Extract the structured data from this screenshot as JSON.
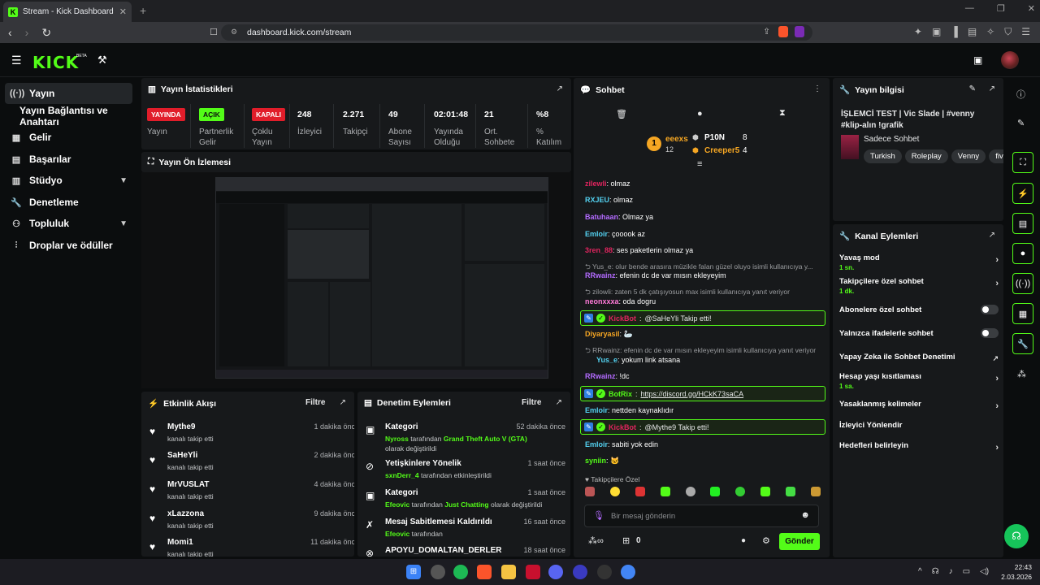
{
  "browser": {
    "tab_title": "Stream - Kick Dashboard",
    "url": "dashboard.kick.com/stream"
  },
  "header": {
    "logo": "KICK",
    "beta": "BETA"
  },
  "sidebar": {
    "items": [
      {
        "label": "Yayın",
        "icon": "broadcast-icon"
      },
      {
        "label": "Yayın Bağlantısı ve Anahtarı"
      },
      {
        "label": "Gelir",
        "icon": "revenue-icon"
      },
      {
        "label": "Başarılar",
        "icon": "achievements-icon"
      },
      {
        "label": "Stüdyo",
        "icon": "studio-icon"
      },
      {
        "label": "Denetleme",
        "icon": "wrench-icon"
      },
      {
        "label": "Topluluk",
        "icon": "community-icon"
      },
      {
        "label": "Droplar ve ödüller",
        "icon": "drops-icon"
      }
    ]
  },
  "stats": {
    "title": "Yayın İstatistikleri",
    "items": [
      {
        "value": "YAYINDA",
        "label": "Yayın",
        "color": "#e11d2a"
      },
      {
        "value": "AÇIK",
        "label": "Partnerlik Gelir",
        "color": "#53fc18"
      },
      {
        "value": "KAPALI",
        "label": "Çoklu Yayın",
        "color": "#e11d2a"
      },
      {
        "value": "248",
        "label": "İzleyici"
      },
      {
        "value": "2.271",
        "label": "Takipçi"
      },
      {
        "value": "49",
        "label": "Abone Sayısı"
      },
      {
        "value": "02:01:48",
        "label": "Yayında Olduğu"
      },
      {
        "value": "21",
        "label": "Ort. Sohbete"
      },
      {
        "value": "%8",
        "label": "% Katılım"
      }
    ]
  },
  "preview": {
    "title": "Yayın Ön İzlemesi"
  },
  "feed": {
    "title": "Etkinlik Akışı",
    "filter": "Filtre",
    "items": [
      {
        "name": "Mythe9",
        "sub": "kanalı takip etti",
        "time": "1 dakika önce"
      },
      {
        "name": "SaHeYli",
        "sub": "kanalı takip etti",
        "time": "2 dakika önce"
      },
      {
        "name": "MrVUSLAT",
        "sub": "kanalı takip etti",
        "time": "4 dakika önce"
      },
      {
        "name": "xLazzona",
        "sub": "kanalı takip etti",
        "time": "9 dakika önce"
      },
      {
        "name": "Momi1",
        "sub": "kanalı takip etti",
        "time": "11 dakika önce"
      }
    ]
  },
  "mod": {
    "title": "Denetim Eylemleri",
    "filter": "Filtre",
    "items": [
      {
        "name": "Kategori",
        "time": "52 dakika önce",
        "a": "Nyross",
        "b": " tarafından ",
        "c": "Grand Theft Auto V (GTA)",
        "d": " olarak değiştirildi"
      },
      {
        "name": "Yetişkinlere Yönelik",
        "time": "1 saat önce",
        "a": "sxnDerr_4",
        "b": " tarafından etkinleştirildi",
        "c": "",
        "d": ""
      },
      {
        "name": "Kategori",
        "time": "1 saat önce",
        "a": "Efeovic",
        "b": " tarafından ",
        "c": "Just Chatting",
        "d": " olarak değiştirildi"
      },
      {
        "name": "Mesaj Sabitlemesi Kaldırıldı",
        "time": "16 saat önce",
        "a": "Efeovic",
        "b": " tarafından",
        "c": "",
        "d": ""
      },
      {
        "name": "APOYU_DOMALTAN_DERLER",
        "time": "18 saat önce",
        "a": "",
        "b": "",
        "c": "",
        "d": ""
      }
    ]
  },
  "chat": {
    "title": "Sohbet",
    "top": {
      "u1": "eeexs",
      "n1": "1",
      "s1": "12",
      "u2": "P10N",
      "c2": "8",
      "u3": "Creeper5",
      "c3": "4"
    },
    "messages": [
      {
        "type": "msg",
        "user": "zilewli",
        "color": "#e0245e",
        "text": "olmaz"
      },
      {
        "type": "msg",
        "user": "RXJEU",
        "color": "#53d1f0",
        "text": "olmaz"
      },
      {
        "type": "msg",
        "user": "Batuhaan",
        "color": "#b36bff",
        "text": "Olmaz ya"
      },
      {
        "type": "msg",
        "user": "Emloir",
        "color": "#53d1f0",
        "text": "çooook az"
      },
      {
        "type": "msg",
        "user": "3ren_88",
        "color": "#e0245e",
        "text": "ses paketlerin olmaz ya"
      },
      {
        "type": "reply",
        "text": "Yus_e: olur bende arasıra müzikle falan güzel oluyo isimli kullanıcıya y..."
      },
      {
        "type": "msg",
        "user": "RRwainz",
        "color": "#b36bff",
        "text": "efenin dc de var mısın ekleyeyim"
      },
      {
        "type": "reply",
        "text": "zilowli: zaten 5 dk çatışıyosun max isimli kullanıcıya yanıt veriyor"
      },
      {
        "type": "msg",
        "user": "neonxxxa",
        "color": "#ff7ad9",
        "text": "oda dogru"
      },
      {
        "type": "hl",
        "user": "KickBot",
        "color": "#e0245e",
        "text": "@SaHeYli Takip etti!"
      },
      {
        "type": "msg",
        "user": "Diyaryasil",
        "color": "#f5a623",
        "text": "🦢"
      },
      {
        "type": "reply",
        "text": "RRwainz: efenin dc de var mısın ekleyeyim isimli kullanıcıya yanıt veriyor"
      },
      {
        "type": "msg",
        "user": "Yus_e",
        "color": "#53d1f0",
        "text": "yokum link atsana"
      },
      {
        "type": "msg",
        "user": "RRwainz",
        "color": "#b36bff",
        "text": "!dc"
      },
      {
        "type": "hl",
        "user": "BotRix",
        "color": "#53fc18",
        "text": "https://discord.gg/HCkK73saCA"
      },
      {
        "type": "msg",
        "user": "Emloir",
        "color": "#53d1f0",
        "text": "nettden kaynaklıdır"
      },
      {
        "type": "hl",
        "user": "KickBot",
        "color": "#e0245e",
        "text": "@Mythe9 Takip etti!"
      },
      {
        "type": "msg",
        "user": "Emloir",
        "color": "#53d1f0",
        "text": "sabiti yok edin"
      },
      {
        "type": "msg",
        "user": "syniin",
        "color": "#53fc18",
        "text": "🐱"
      }
    ],
    "emote_label": "Takipçilere Özel",
    "placeholder": "Bir mesaj gönderin",
    "count": "0",
    "send": "Gönder"
  },
  "info": {
    "title": "Yayın bilgisi",
    "stream_title": "İŞLEMCİ TEST | Vic Slade | #venny #klip-alın !grafik",
    "category": "Sadece Sohbet",
    "tags": [
      "Turkish",
      "Roleplay",
      "Venny",
      "fiv"
    ]
  },
  "actions": {
    "title": "Kanal Eylemleri",
    "items": [
      {
        "label": "Yavaş mod",
        "sub": "1 sn.",
        "kind": "chev"
      },
      {
        "label": "Takipçilere özel sohbet",
        "sub": "1 dk.",
        "kind": "chev"
      },
      {
        "label": "Abonelere özel sohbet",
        "sub": "",
        "kind": "toggle"
      },
      {
        "label": "Yalnızca ifadelerle sohbet",
        "sub": "",
        "kind": "toggle"
      },
      {
        "label": "Yapay Zeka ile Sohbet Denetimi",
        "sub": "",
        "kind": "ext"
      },
      {
        "label": "Hesap yaşı kısıtlaması",
        "sub": "1 sa.",
        "kind": "chev"
      },
      {
        "label": "Yasaklanmış kelimeler",
        "sub": "",
        "kind": "chev"
      },
      {
        "label": "İzleyici Yönlendir",
        "sub": "",
        "kind": "none"
      },
      {
        "label": "Hedefleri belirleyin",
        "sub": "",
        "kind": "chev"
      }
    ]
  },
  "clock": {
    "time": "22:43",
    "date": "2.03.2026"
  }
}
